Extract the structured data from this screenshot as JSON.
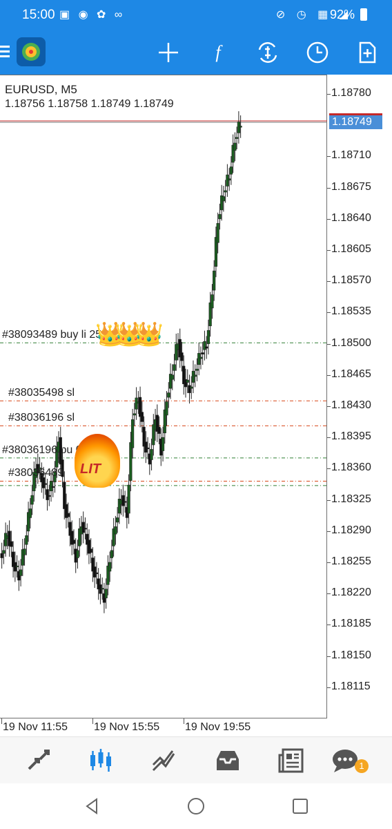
{
  "status_bar": {
    "time": "15:00",
    "battery": "92%"
  },
  "toolbar": {
    "icons": [
      "menu-icon",
      "app-logo-icon",
      "crosshair-icon",
      "indicators-icon",
      "trade-icon",
      "timeframe-icon",
      "add-chart-icon"
    ],
    "indicators_glyph": "f"
  },
  "chart": {
    "symbol": "EURUSD, M5",
    "ohlc": "1.18756 1.18758 1.18749 1.18749",
    "current_price": "1.18749",
    "price_ticks": [
      "1.18780",
      "1.18710",
      "1.18675",
      "1.18640",
      "1.18605",
      "1.18570",
      "1.18535",
      "1.18500",
      "1.18465",
      "1.18430",
      "1.18395",
      "1.18360",
      "1.18325",
      "1.18290",
      "1.18255",
      "1.18220",
      "1.18185",
      "1.18150",
      "1.18115"
    ],
    "time_labels": [
      "19 Nov 11:55",
      "19 Nov 15:55",
      "19 Nov 19:55"
    ],
    "orders": [
      {
        "label": "#38093489 buy li",
        "suffix": "25",
        "color": "#2e7d32",
        "price": 1.18501
      },
      {
        "label": "#38035498 sl",
        "color": "#d84315",
        "price": 1.18436
      },
      {
        "label": "#38036196 sl",
        "color": "#d84315",
        "price": 1.18408
      },
      {
        "label": "#38036196 bu",
        "suffix": "00",
        "color": "#2e7d32",
        "price": 1.18372
      },
      {
        "label": "#38036489",
        "color": "#d84315",
        "price": 1.18346
      },
      {
        "label": "",
        "color": "#2e7d32",
        "price": 1.18341
      }
    ],
    "stickers": {
      "lit": "LIT"
    },
    "colors": {
      "bull": "#1b5e20",
      "bear": "#111111",
      "accent": "#1e88e5"
    }
  },
  "chart_data": {
    "type": "line",
    "title": "EURUSD, M5",
    "ylim": [
      1.18085,
      1.18795
    ],
    "x": [
      "19 Nov 11:55",
      "19 Nov 15:55",
      "19 Nov 19:55"
    ],
    "series": [
      {
        "values": [
          1.18265,
          1.1829,
          1.18255,
          1.1824,
          1.18275,
          1.1832,
          1.18365,
          1.1835,
          1.1833,
          1.18345,
          1.18395,
          1.1832,
          1.1829,
          1.1826,
          1.183,
          1.1828,
          1.1825,
          1.1823,
          1.18215,
          1.1826,
          1.183,
          1.1833,
          1.1831,
          1.1842,
          1.1844,
          1.1839,
          1.1837,
          1.1842,
          1.1838,
          1.1844,
          1.1847,
          1.18505,
          1.1846,
          1.1845,
          1.1847,
          1.1849,
          1.185,
          1.1856,
          1.1864,
          1.1867,
          1.1869,
          1.1873,
          1.18749
        ]
      }
    ]
  }
}
